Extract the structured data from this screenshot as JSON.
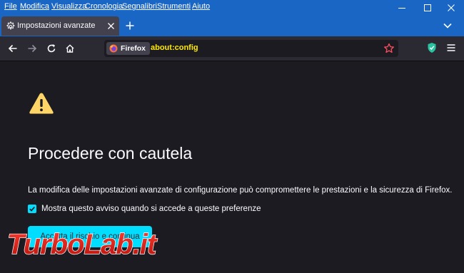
{
  "menubar": {
    "items": [
      "File",
      "Modifica",
      "Visualizza",
      "Cronologia",
      "Segnalibri",
      "Strumenti",
      "Aiuto"
    ]
  },
  "window_controls": [
    "minimize",
    "maximize",
    "close"
  ],
  "tab": {
    "title": "Impostazioni avanzate",
    "icon": "gear-icon"
  },
  "toolbar": {
    "identity_label": "Firefox",
    "url": "about:config"
  },
  "page": {
    "title": "Procedere con cautela",
    "description": "La modifica delle impostazioni avanzate di configurazione può compromettere le prestazioni e la sicurezza di Firefox.",
    "checkbox_label": "Mostra questo avviso quando si accede a queste preferenze",
    "checkbox_checked": true,
    "accept_button": "Accetta il rischio e continua"
  },
  "watermark": {
    "text": "TurboLab.it"
  },
  "colors": {
    "titlebar": "#1a66c4",
    "toolbar": "#2b2a33",
    "content": "#1c1b22",
    "accent": "#00ddff",
    "url_text": "#ffe900",
    "warning": "#ffd567"
  }
}
